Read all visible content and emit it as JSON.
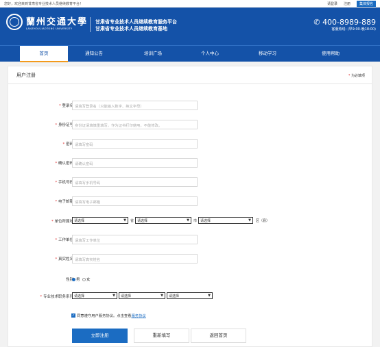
{
  "topbar": {
    "welcome": "您好，欢迎来到甘肃省专业技术人员继续教育平台！",
    "login": "请登录",
    "register": "注册",
    "group_register": "集体报名"
  },
  "header": {
    "school_cn": "蘭州交通大學",
    "school_en": "LANZHOU JIAOTONG UNIVERSITY",
    "platform_line1": "甘肃省专业技术人员继续教育服务平台",
    "platform_line2": "甘肃省专业技术人员继续教育基地",
    "hotline_icon": "phone-icon",
    "hotline": "400-8989-889",
    "service_hours": "客服热线: (早9:00-晚18:00)"
  },
  "nav": [
    "首页",
    "通知公告",
    "培训广场",
    "个人中心",
    "移动学习",
    "使用帮助"
  ],
  "page": {
    "title": "用户注册",
    "required_note": "为必填项",
    "required_mark": "*"
  },
  "form": {
    "fields": [
      {
        "label": "登录名",
        "placeholder": "请填写登录名（只能输入数字、英文字母）"
      },
      {
        "label": "身份证号",
        "placeholder": "身份证请填慎重填写，作为证书打印使用，不能修改。"
      },
      {
        "label": "密码",
        "placeholder": "请填写密码"
      },
      {
        "label": "确认密码",
        "placeholder": "请确认密码"
      },
      {
        "label": "手机号码",
        "placeholder": "请填写手机号码"
      },
      {
        "label": "电子邮箱",
        "placeholder": "请填写电子邮箱"
      }
    ],
    "unit_location": {
      "label": "单位所属地",
      "province": "请选择",
      "province_unit": "省",
      "city": "请选择",
      "city_unit": "市",
      "district": "请选择",
      "district_unit": "区（县）"
    },
    "more_fields": [
      {
        "label": "工作单位",
        "placeholder": "请填写工作单位"
      },
      {
        "label": "真实姓名",
        "placeholder": "请填写真实姓名"
      }
    ],
    "gender": {
      "label": "性别",
      "options": [
        "男",
        "女"
      ],
      "selected": "男"
    },
    "title_series": {
      "label": "专业技术职务系列",
      "options": [
        "请选择",
        "请选择",
        "请选择"
      ]
    },
    "agreement": {
      "text": "同意遵守用户服务协议。点击查看",
      "link": "服务协议",
      "checked": true
    }
  },
  "buttons": {
    "submit": "立即注册",
    "reset": "重新填写",
    "home": "返回首页"
  },
  "colors": {
    "brand": "#1452a8",
    "accent": "#1b6cc2",
    "active_underline": "#f39a1b",
    "required": "#e02b2b"
  }
}
